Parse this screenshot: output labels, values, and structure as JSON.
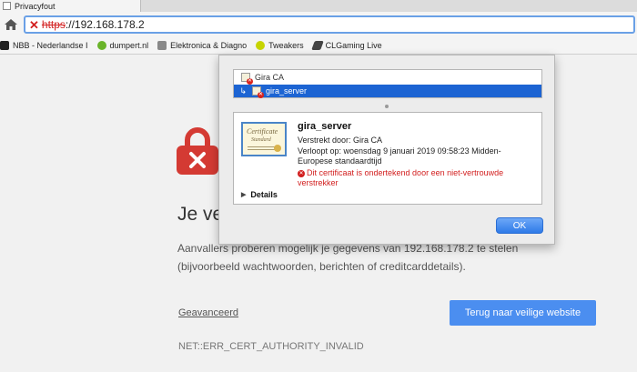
{
  "tab": {
    "title": "Privacyfout"
  },
  "omnibox": {
    "scheme": "https",
    "rest": "://192.168.178.2"
  },
  "bookmarks": [
    {
      "label": "NBB - Nederlandse I",
      "icon": "nbb-favicon",
      "color": "#222222"
    },
    {
      "label": "dumpert.nl",
      "icon": "dumpert-favicon",
      "color": "#6ab42a"
    },
    {
      "label": "Elektronica & Diagno",
      "icon": "elektronica-favicon",
      "color": "#888888"
    },
    {
      "label": "Tweakers",
      "icon": "tweakers-favicon",
      "color": "#c7d400"
    },
    {
      "label": "CLGaming Live",
      "icon": "clgaming-favicon",
      "color": "#444444"
    }
  ],
  "error": {
    "heading": "Je ve",
    "body": "Aanvallers proberen mogelijk je gegevens van 192.168.178.2 te stelen (bijvoorbeeld wachtwoorden, berichten of creditcarddetails).",
    "advanced_link": "Geavanceerd",
    "back_button": "Terug naar veilige website",
    "code": "NET::ERR_CERT_AUTHORITY_INVALID"
  },
  "certificate": {
    "chain": [
      "Gira CA",
      "gira_server"
    ],
    "name": "gira_server",
    "issuer": "Verstrekt door: Gira CA",
    "expiry": "Verloopt op: woensdag 9 januari 2019 09:58:23 Midden-Europese standaardtijd",
    "warning": "Dit certificaat is ondertekend door een niet-vertrouwde verstrekker",
    "details_label": "Details",
    "ok_button": "OK",
    "image_title": "Certificate",
    "image_subtitle": "Standard"
  },
  "colors": {
    "lock": "#d43a33",
    "accent": "#4b8ef0",
    "selection": "#1c64d3",
    "error_text": "#d21f1f"
  }
}
